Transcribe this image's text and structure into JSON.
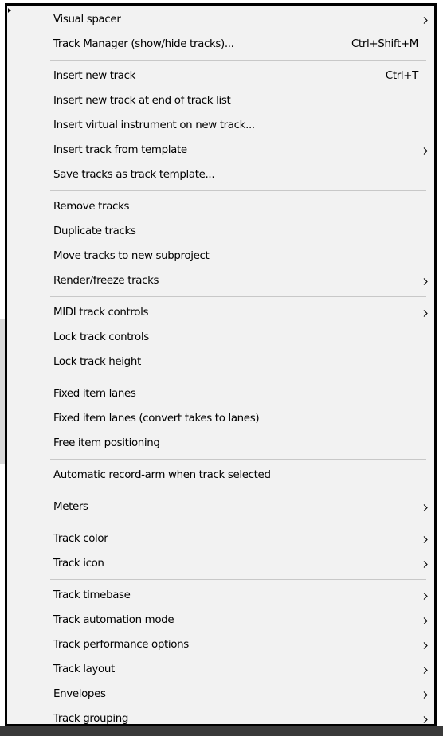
{
  "menu": {
    "sections": [
      [
        {
          "label": "Visual spacer",
          "shortcut": "",
          "submenu": true
        },
        {
          "label": "Track Manager (show/hide tracks)...",
          "shortcut": "Ctrl+Shift+M",
          "submenu": false
        }
      ],
      [
        {
          "label": "Insert new track",
          "shortcut": "Ctrl+T",
          "submenu": false
        },
        {
          "label": "Insert new track at end of track list",
          "shortcut": "",
          "submenu": false
        },
        {
          "label": "Insert virtual instrument on new track...",
          "shortcut": "",
          "submenu": false
        },
        {
          "label": "Insert track from template",
          "shortcut": "",
          "submenu": true
        },
        {
          "label": "Save tracks as track template...",
          "shortcut": "",
          "submenu": false
        }
      ],
      [
        {
          "label": "Remove tracks",
          "shortcut": "",
          "submenu": false
        },
        {
          "label": "Duplicate tracks",
          "shortcut": "",
          "submenu": false
        },
        {
          "label": "Move tracks to new subproject",
          "shortcut": "",
          "submenu": false
        },
        {
          "label": "Render/freeze tracks",
          "shortcut": "",
          "submenu": true
        }
      ],
      [
        {
          "label": "MIDI track controls",
          "shortcut": "",
          "submenu": true
        },
        {
          "label": "Lock track controls",
          "shortcut": "",
          "submenu": false
        },
        {
          "label": "Lock track height",
          "shortcut": "",
          "submenu": false
        }
      ],
      [
        {
          "label": "Fixed item lanes",
          "shortcut": "",
          "submenu": false
        },
        {
          "label": "Fixed item lanes (convert takes to lanes)",
          "shortcut": "",
          "submenu": false
        },
        {
          "label": "Free item positioning",
          "shortcut": "",
          "submenu": false
        }
      ],
      [
        {
          "label": "Automatic record-arm when track selected",
          "shortcut": "",
          "submenu": false
        }
      ],
      [
        {
          "label": "Meters",
          "shortcut": "",
          "submenu": true
        }
      ],
      [
        {
          "label": "Track color",
          "shortcut": "",
          "submenu": true
        },
        {
          "label": "Track icon",
          "shortcut": "",
          "submenu": true
        }
      ],
      [
        {
          "label": "Track timebase",
          "shortcut": "",
          "submenu": true
        },
        {
          "label": "Track automation mode",
          "shortcut": "",
          "submenu": true
        },
        {
          "label": "Track performance options",
          "shortcut": "",
          "submenu": true
        },
        {
          "label": "Track layout",
          "shortcut": "",
          "submenu": true
        },
        {
          "label": "Envelopes",
          "shortcut": "",
          "submenu": true
        },
        {
          "label": "Track grouping",
          "shortcut": "",
          "submenu": true
        }
      ]
    ],
    "colors": {
      "background": "#f2f2f2",
      "border": "#000000",
      "separator": "#c8c8c8",
      "text": "#000000"
    },
    "icons": {
      "submenu": "chevron-right-icon"
    }
  }
}
